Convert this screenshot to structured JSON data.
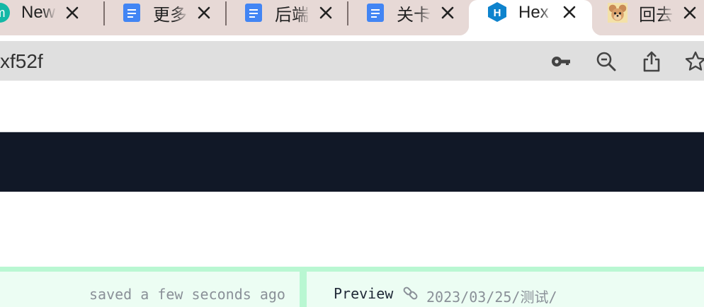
{
  "tabs": [
    {
      "label": "New",
      "icon": "m-badge-icon",
      "active": false
    },
    {
      "label": "更多",
      "icon": "google-docs-icon",
      "active": false
    },
    {
      "label": "后端",
      "icon": "google-docs-icon",
      "active": false
    },
    {
      "label": "关卡",
      "icon": "google-docs-icon",
      "active": false
    },
    {
      "label": "Hex",
      "icon": "hexo-icon",
      "active": true
    },
    {
      "label": "回去",
      "icon": "jerry-avatar-icon",
      "active": false
    }
  ],
  "address": {
    "url": "xf52f"
  },
  "editor": {
    "saved_status": "saved a few seconds ago",
    "preview_label": "Preview",
    "preview_path": "2023/03/25/测试/"
  },
  "colors": {
    "tabstrip": "#e7d9d6",
    "dark_band": "#111827",
    "editor_bar": "#ecfdf3",
    "editor_accent": "#b9f7d2",
    "docs_blue": "#4285f4",
    "hexo_blue": "#0e83cd"
  }
}
